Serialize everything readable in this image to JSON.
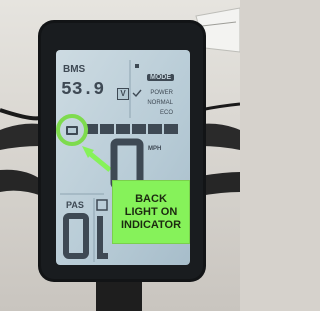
{
  "display": {
    "bms_label": "BMS",
    "battery_voltage": "53.9",
    "voltage_unit": "V",
    "mode_label": "MODE",
    "modes": [
      "POWER",
      "NORMAL",
      "ECO"
    ],
    "speed_unit": "MPH",
    "speed_value": "0",
    "pas_label": "PAS",
    "pas_value": "0"
  },
  "callout": {
    "lines": [
      "BACK",
      "LIGHT ON",
      "INDICATOR"
    ]
  },
  "colors": {
    "highlight_circle": "#7edb4e",
    "callout_fill": "#86f25a",
    "lcd_background": "#b7cbd6",
    "lcd_segments": "#3e4954",
    "device_frame": "#121416"
  }
}
